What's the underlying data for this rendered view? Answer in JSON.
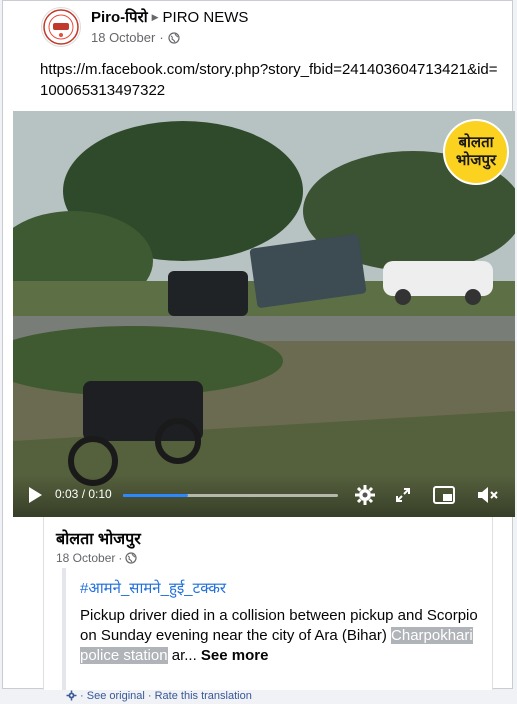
{
  "post": {
    "author": "Piro-पिरो",
    "page": "PIRO NEWS",
    "date": "18 October",
    "dot": "·",
    "link_text": "https://m.facebook.com/story.php?story_fbid=241403604713421&id=100065313497322"
  },
  "video": {
    "badge_line1": "बोलता",
    "badge_line2": "भोजपुर",
    "time": "0:03 / 0:10",
    "progress_fraction": 0.3
  },
  "shared": {
    "author": "बोलता भोजपुर",
    "date": "18 October",
    "dot": "·",
    "hashtag": "#आमने_सामने_हुई_टक्कर",
    "text_main": "Pickup driver died in a collision between pickup and Scorpio on Sunday evening near the city of Ara (Bihar) ",
    "text_highlight": "Charpokhari police station",
    "text_tail": " ar...",
    "see_more": " See more",
    "see_original": "See original",
    "translation_dot": " · ",
    "rate_translation": "Rate this translation"
  },
  "colors": {
    "link_blue": "#216fdb",
    "progress_blue": "#2d88ff",
    "badge_yellow": "#fbd21f"
  },
  "icons": [
    "globe-icon",
    "play-icon",
    "settings-icon",
    "fullscreen-icon",
    "picture-in-picture-icon",
    "mute-icon",
    "gear-icon"
  ]
}
